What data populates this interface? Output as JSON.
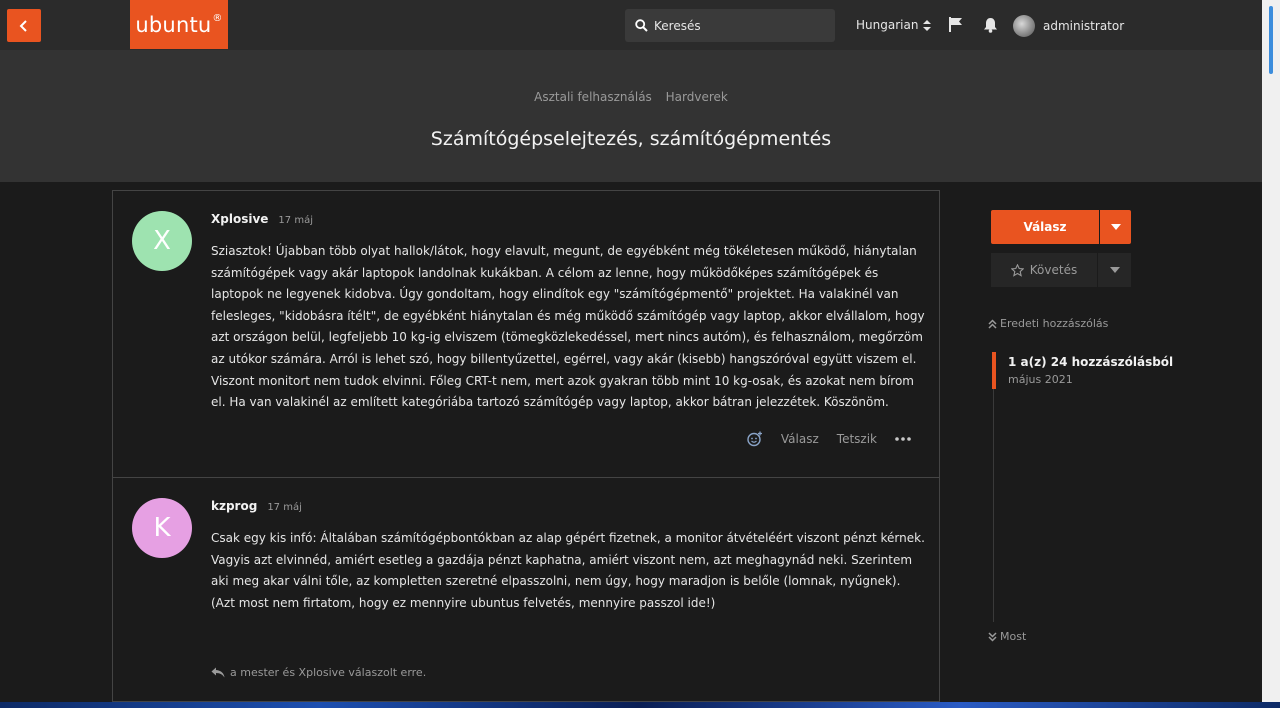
{
  "topbar": {
    "logo_text": "ubuntu",
    "logo_mark": "®",
    "search_placeholder": "Keresés",
    "language": "Hungarian",
    "username": "administrator"
  },
  "header": {
    "breadcrumbs": [
      "Asztali felhasználás",
      "Hardverek"
    ],
    "title": "Számítógépselejtezés, számítógépmentés"
  },
  "posts": [
    {
      "avatar_letter": "X",
      "avatar_color": "#9ee3b0",
      "author": "Xplosive",
      "date": "17 máj",
      "body": "Sziasztok! Újabban több olyat hallok/látok, hogy elavult, megunt, de egyébként még tökéletesen működő, hiánytalan számítógépek vagy akár laptopok landolnak kukákban. A célom az lenne, hogy működőképes számítógépek és laptopok ne legyenek kidobva. Úgy gondoltam, hogy elindítok egy \"számítógépmentő\" projektet. Ha valakinél van felesleges, \"kidobásra ítélt\", de egyébként hiánytalan és még működő számítógép vagy laptop, akkor elvállalom, hogy azt országon belül, legfeljebb 10 kg-ig elviszem (tömegközlekedéssel, mert nincs autóm), és felhasználom, megőrzöm az utókor számára. Arról is lehet szó, hogy billentyűzettel, egérrel, vagy akár (kisebb) hangszóróval együtt viszem el. Viszont monitort nem tudok elvinni. Főleg CRT-t nem, mert azok gyakran több mint 10 kg-osak, és azokat nem bírom el. Ha van valakinél az említett kategóriába tartozó számítógép vagy laptop, akkor bátran jelezzétek. Köszönöm.",
      "actions": {
        "reply": "Válasz",
        "like": "Tetszik"
      }
    },
    {
      "avatar_letter": "K",
      "avatar_color": "#e6a0e3",
      "author": "kzprog",
      "date": "17 máj",
      "body": "Csak egy kis infó: Általában számítógépbontókban az alap gépért fizetnek, a monitor átvételéért viszont pénzt kérnek. Vagyis azt elvinnéd, amiért esetleg a gazdája pénzt kaphatna, amiért viszont nem, azt meghagynád neki. Szerintem aki meg akar válni tőle, az kompletten szeretné elpasszolni, nem úgy, hogy maradjon is belőle (lomnak, nyűgnek). (Azt most nem firtatom, hogy ez mennyire ubuntus felvetés, mennyire passzol ide!)",
      "replied_by": "a mester és Xplosive válaszolt erre."
    }
  ],
  "sidebar": {
    "reply_label": "Válasz",
    "follow_label": "Követés",
    "original_post": "Eredeti hozzászólás",
    "timeline_count": "1 a(z) 24 hozzászólásból",
    "timeline_date": "május 2021",
    "latest": "Most"
  },
  "colors": {
    "accent": "#e95420"
  }
}
